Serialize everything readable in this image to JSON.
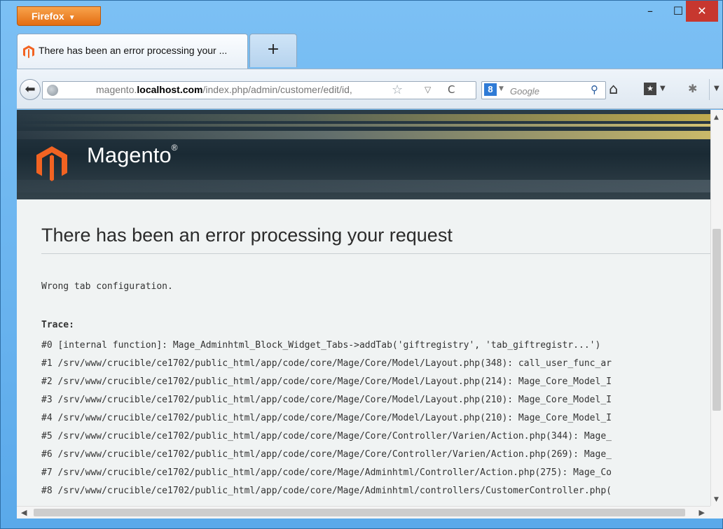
{
  "browser": {
    "app_menu_label": "Firefox",
    "app_menu_arrow": "▼",
    "window_controls": {
      "minimize": "–",
      "maximize": "☐",
      "close": "✕"
    },
    "tab": {
      "title": "There has been an error processing your ...",
      "icon": "magento-favicon"
    },
    "new_tab_label": "+",
    "url": {
      "prefix": "magento.",
      "host": "localhost.com",
      "path": "/index.php/admin/customer/edit/id,"
    },
    "search": {
      "engine_icon": "8",
      "placeholder": "Google"
    }
  },
  "page": {
    "logo_text": "Magento",
    "logo_mark": "®",
    "error_title": "There has been an error processing your request",
    "message": "Wrong tab configuration.",
    "trace_label": "Trace:",
    "trace": [
      "#0 [internal function]: Mage_Adminhtml_Block_Widget_Tabs->addTab('giftregistry', 'tab_giftregistr...')",
      "#1 /srv/www/crucible/ce1702/public_html/app/code/core/Mage/Core/Model/Layout.php(348): call_user_func_ar",
      "#2 /srv/www/crucible/ce1702/public_html/app/code/core/Mage/Core/Model/Layout.php(214): Mage_Core_Model_I",
      "#3 /srv/www/crucible/ce1702/public_html/app/code/core/Mage/Core/Model/Layout.php(210): Mage_Core_Model_I",
      "#4 /srv/www/crucible/ce1702/public_html/app/code/core/Mage/Core/Model/Layout.php(210): Mage_Core_Model_I",
      "#5 /srv/www/crucible/ce1702/public_html/app/code/core/Mage/Core/Controller/Varien/Action.php(344): Mage_",
      "#6 /srv/www/crucible/ce1702/public_html/app/code/core/Mage/Core/Controller/Varien/Action.php(269): Mage_",
      "#7 /srv/www/crucible/ce1702/public_html/app/code/core/Mage/Adminhtml/Controller/Action.php(275): Mage_Co",
      "#8 /srv/www/crucible/ce1702/public_html/app/code/core/Mage/Adminhtml/controllers/CustomerController.php("
    ]
  },
  "colors": {
    "firefox_orange": "#e36d12",
    "magento_orange": "#f26322",
    "window_blue": "#6fb6f0"
  }
}
